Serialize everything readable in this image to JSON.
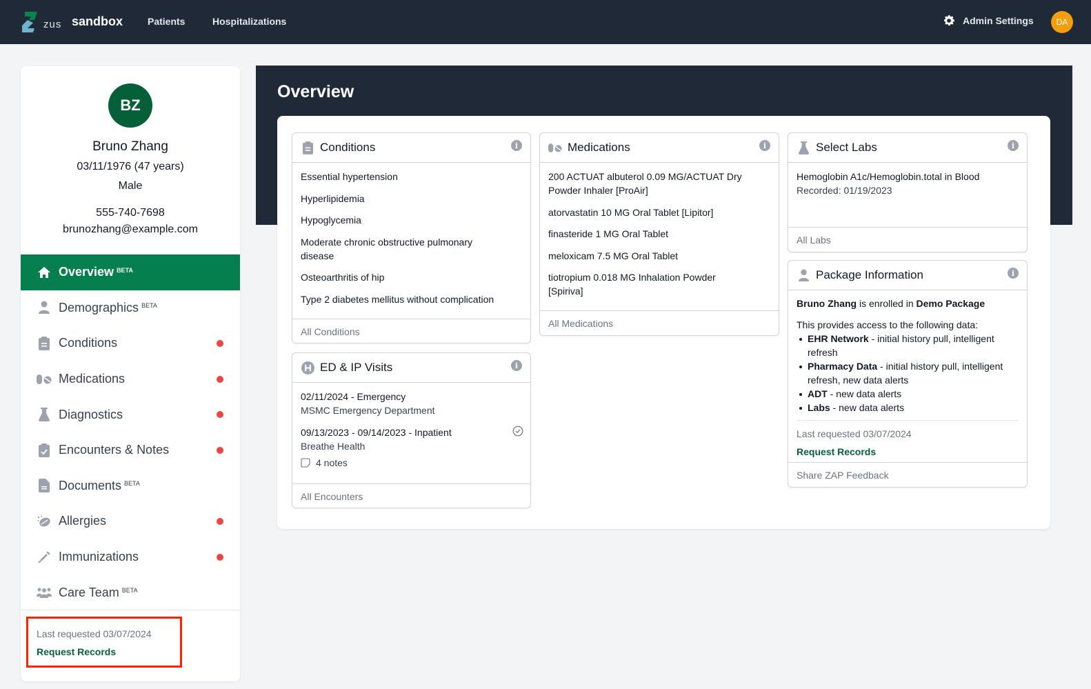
{
  "topnav": {
    "logo_word": "zus",
    "brand": "sandbox",
    "links": [
      "Patients",
      "Hospitalizations"
    ],
    "admin_label": "Admin Settings",
    "user_initials": "DA",
    "colors": {
      "bg": "#1f2937",
      "user_avatar": "#f59e0b"
    }
  },
  "patient": {
    "initials": "BZ",
    "name": "Bruno Zhang",
    "dob_age": "03/11/1976 (47 years)",
    "sex": "Male",
    "phone": "555-740-7698",
    "email": "brunozhang@example.com"
  },
  "sidebar": {
    "items": [
      {
        "label": "Overview",
        "badge": "BETA",
        "icon": "home-icon",
        "active": true,
        "alert": false
      },
      {
        "label": "Demographics",
        "badge": "BETA",
        "icon": "user-icon",
        "active": false,
        "alert": false
      },
      {
        "label": "Conditions",
        "badge": "",
        "icon": "clipboard-list-icon",
        "active": false,
        "alert": true
      },
      {
        "label": "Medications",
        "badge": "",
        "icon": "pills-icon",
        "active": false,
        "alert": true
      },
      {
        "label": "Diagnostics",
        "badge": "",
        "icon": "flask-icon",
        "active": false,
        "alert": true
      },
      {
        "label": "Encounters & Notes",
        "badge": "",
        "icon": "clipboard-check-icon",
        "active": false,
        "alert": true
      },
      {
        "label": "Documents",
        "badge": "BETA",
        "icon": "file-icon",
        "active": false,
        "alert": false
      },
      {
        "label": "Allergies",
        "badge": "",
        "icon": "allergen-icon",
        "active": false,
        "alert": true
      },
      {
        "label": "Immunizations",
        "badge": "",
        "icon": "syringe-icon",
        "active": false,
        "alert": true
      },
      {
        "label": "Care Team",
        "badge": "BETA",
        "icon": "users-icon",
        "active": false,
        "alert": false
      }
    ],
    "last_requested": "Last requested 03/07/2024",
    "request_records": "Request Records",
    "colors": {
      "active_bg": "#047f4d",
      "alert_dot": "#ef4444",
      "link": "#05603a"
    }
  },
  "main": {
    "title": "Overview",
    "conditions": {
      "title": "Conditions",
      "items": [
        "Essential hypertension",
        "Hyperlipidemia",
        "Hypoglycemia",
        "Moderate chronic obstructive pulmonary disease",
        "Osteoarthritis of hip",
        "Type 2 diabetes mellitus without complication"
      ],
      "footer": "All Conditions"
    },
    "medications": {
      "title": "Medications",
      "items": [
        "200 ACTUAT albuterol 0.09 MG/ACTUAT Dry Powder Inhaler [ProAir]",
        "atorvastatin 10 MG Oral Tablet [Lipitor]",
        "finasteride 1 MG Oral Tablet",
        "meloxicam 7.5 MG Oral Tablet",
        "tiotropium 0.018 MG Inhalation Powder [Spiriva]"
      ],
      "footer": "All Medications"
    },
    "labs": {
      "title": "Select Labs",
      "lab_name": "Hemoglobin A1c/Hemoglobin.total in Blood",
      "recorded": "Recorded: 01/19/2023",
      "footer": "All Labs"
    },
    "visits": {
      "title": "ED & IP Visits",
      "items": [
        {
          "title": "02/11/2024 - Emergency",
          "facility": "MSMC Emergency Department",
          "reviewed": false,
          "notes": ""
        },
        {
          "title": "09/13/2023 - 09/14/2023 - Inpatient",
          "facility": "Breathe Health",
          "reviewed": true,
          "notes": "4 notes"
        }
      ],
      "footer": "All Encounters"
    },
    "package": {
      "title": "Package Information",
      "patient_name": "Bruno Zhang",
      "enrolled_text": " is enrolled in ",
      "package_name": "Demo Package",
      "intro": "This provides access to the following data:",
      "features": [
        {
          "name": "EHR Network",
          "desc": " - initial history pull, intelligent refresh"
        },
        {
          "name": "Pharmacy Data",
          "desc": " - initial history pull, intelligent refresh, new data alerts"
        },
        {
          "name": "ADT",
          "desc": " - new data alerts"
        },
        {
          "name": "Labs",
          "desc": " - new data alerts"
        }
      ],
      "last_requested": "Last requested 03/07/2024",
      "request_records": "Request Records",
      "footer": "Share ZAP Feedback"
    }
  }
}
